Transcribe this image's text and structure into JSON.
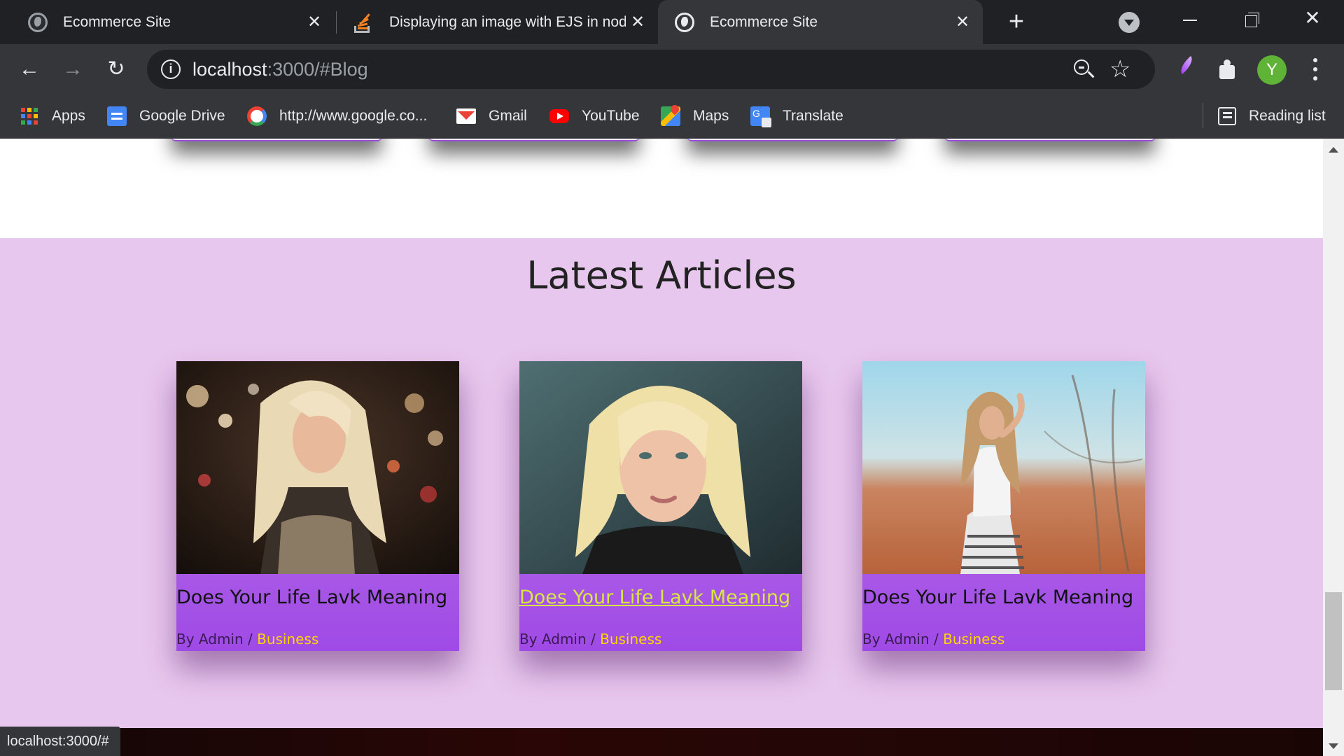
{
  "tabs": [
    {
      "title": "Ecommerce Site",
      "active": false,
      "icon": "globe-icon"
    },
    {
      "title": "Displaying an image with EJS in nod",
      "active": false,
      "icon": "stackoverflow-icon"
    },
    {
      "title": "Ecommerce Site",
      "active": true,
      "icon": "globe-icon"
    }
  ],
  "tab_close_glyph": "✕",
  "new_tab_glyph": "+",
  "address": {
    "host": "localhost",
    "rest": ":3000/#Blog"
  },
  "toolbar": {
    "back_glyph": "←",
    "forward_glyph": "→",
    "reload_glyph": "↻",
    "info_glyph": "i",
    "star_glyph": "☆",
    "avatar_letter": "Y"
  },
  "bookmarks": [
    {
      "label": "Apps",
      "icon": "apps-grid-icon"
    },
    {
      "label": "Google Drive",
      "icon": "google-drive-icon"
    },
    {
      "label": "http://www.google.co...",
      "icon": "google-icon"
    },
    {
      "label": "Gmail",
      "icon": "gmail-icon"
    },
    {
      "label": "YouTube",
      "icon": "youtube-icon"
    },
    {
      "label": "Maps",
      "icon": "maps-icon"
    },
    {
      "label": "Translate",
      "icon": "translate-icon"
    }
  ],
  "reading_list": "Reading list",
  "page": {
    "section_title": "Latest Articles",
    "articles": [
      {
        "title": "Does Your Life Lavk Meaning",
        "by": "By Admin / ",
        "category": "Business",
        "hovered": false
      },
      {
        "title": "Does Your Life Lavk Meaning",
        "by": "By Admin / ",
        "category": "Business",
        "hovered": true
      },
      {
        "title": "Does Your Life Lavk Meaning",
        "by": "By Admin / ",
        "category": "Business",
        "hovered": false
      }
    ]
  },
  "status_url": "localhost:3000/#",
  "colors": {
    "section_bg": "#e8c7ee",
    "card_gradient_top": "#c17ee6",
    "card_gradient_bottom": "#9f4ae6",
    "category": "#ffd400",
    "hover_link": "#d8e642"
  }
}
